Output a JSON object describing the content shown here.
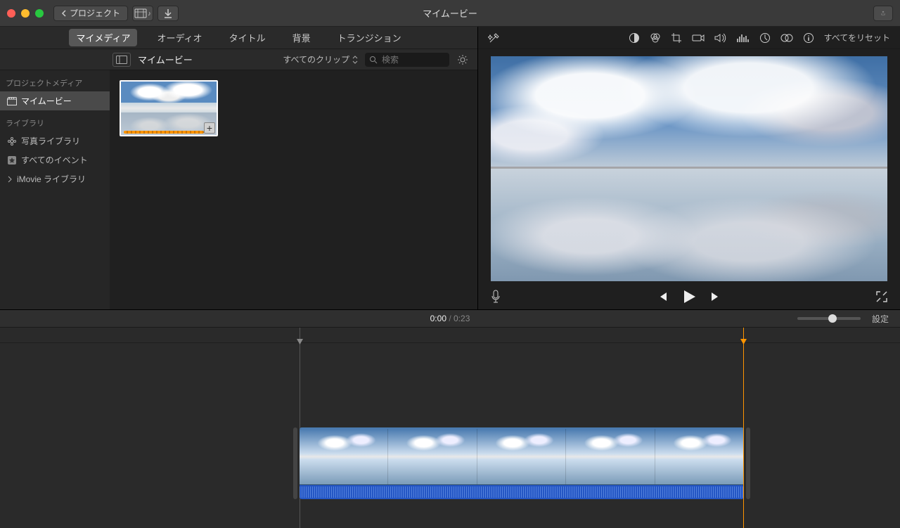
{
  "titlebar": {
    "back_label": "プロジェクト",
    "title": "マイムービー"
  },
  "tabs": {
    "my_media": "マイメディア",
    "audio": "オーディオ",
    "titles": "タイトル",
    "backgrounds": "背景",
    "transitions": "トランジション"
  },
  "browser": {
    "title": "マイムービー",
    "clip_filter": "すべてのクリップ",
    "search_placeholder": "検索"
  },
  "sidebar": {
    "project_media_header": "プロジェクトメディア",
    "my_movie": "マイムービー",
    "library_header": "ライブラリ",
    "photo_library": "写真ライブラリ",
    "all_events": "すべてのイベント",
    "imovie_library": "iMovie ライブラリ"
  },
  "adjust": {
    "reset_all": "すべてをリセット"
  },
  "time": {
    "current": "0:00",
    "total": "0:23",
    "settings": "設定"
  }
}
